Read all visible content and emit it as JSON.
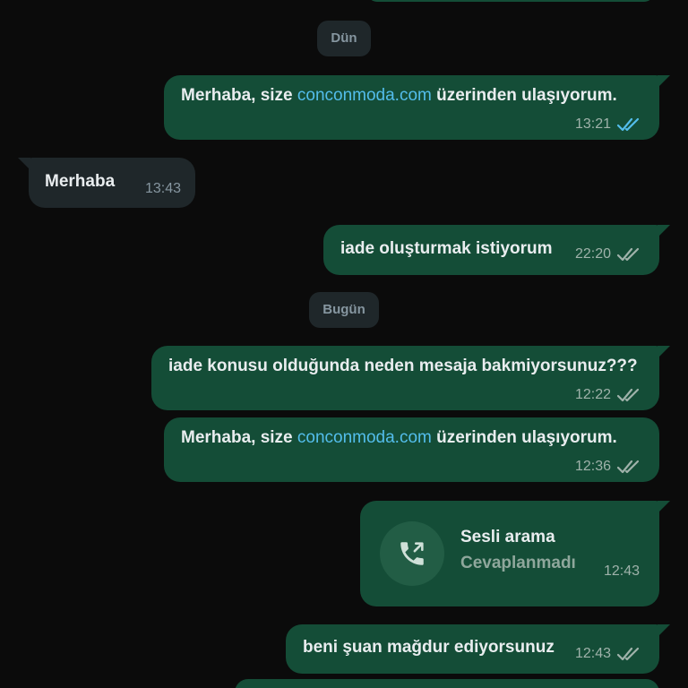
{
  "date_separators": {
    "yesterday": "Dün",
    "today": "Bugün"
  },
  "messages": [
    {
      "id": "m1",
      "text_before": "Merhaba, size ",
      "link": "conconmoda.com",
      "text_after": " üzerinden ulaşıyorum.",
      "time": "13:21",
      "ticks": "read"
    },
    {
      "id": "m2",
      "text": "Merhaba",
      "time": "13:43"
    },
    {
      "id": "m3",
      "text": "iade oluşturmak istiyorum",
      "time": "22:20",
      "ticks": "delivered"
    },
    {
      "id": "m4",
      "text": "iade konusu olduğunda neden mesaja bakmiyorsunuz???",
      "time": "12:22",
      "ticks": "delivered"
    },
    {
      "id": "m5",
      "text_before": "Merhaba, size ",
      "link": "conconmoda.com",
      "text_after": " üzerinden ulaşıyorum.",
      "time": "12:36",
      "ticks": "delivered"
    },
    {
      "id": "m6",
      "call_title": "Sesli arama",
      "call_status": "Cevaplanmadı",
      "time": "12:43",
      "icon": "outgoing-call-icon"
    },
    {
      "id": "m7",
      "text": "beni şuan mağdur ediyorsunuz",
      "time": "12:43",
      "ticks": "delivered"
    }
  ],
  "colors": {
    "outgoing_bubble": "#144d37",
    "incoming_bubble": "#1f272a",
    "link": "#53bdeb",
    "read_ticks": "#53bdeb",
    "delivered_ticks": "#9fb2aa",
    "background": "#0b0b0b"
  }
}
